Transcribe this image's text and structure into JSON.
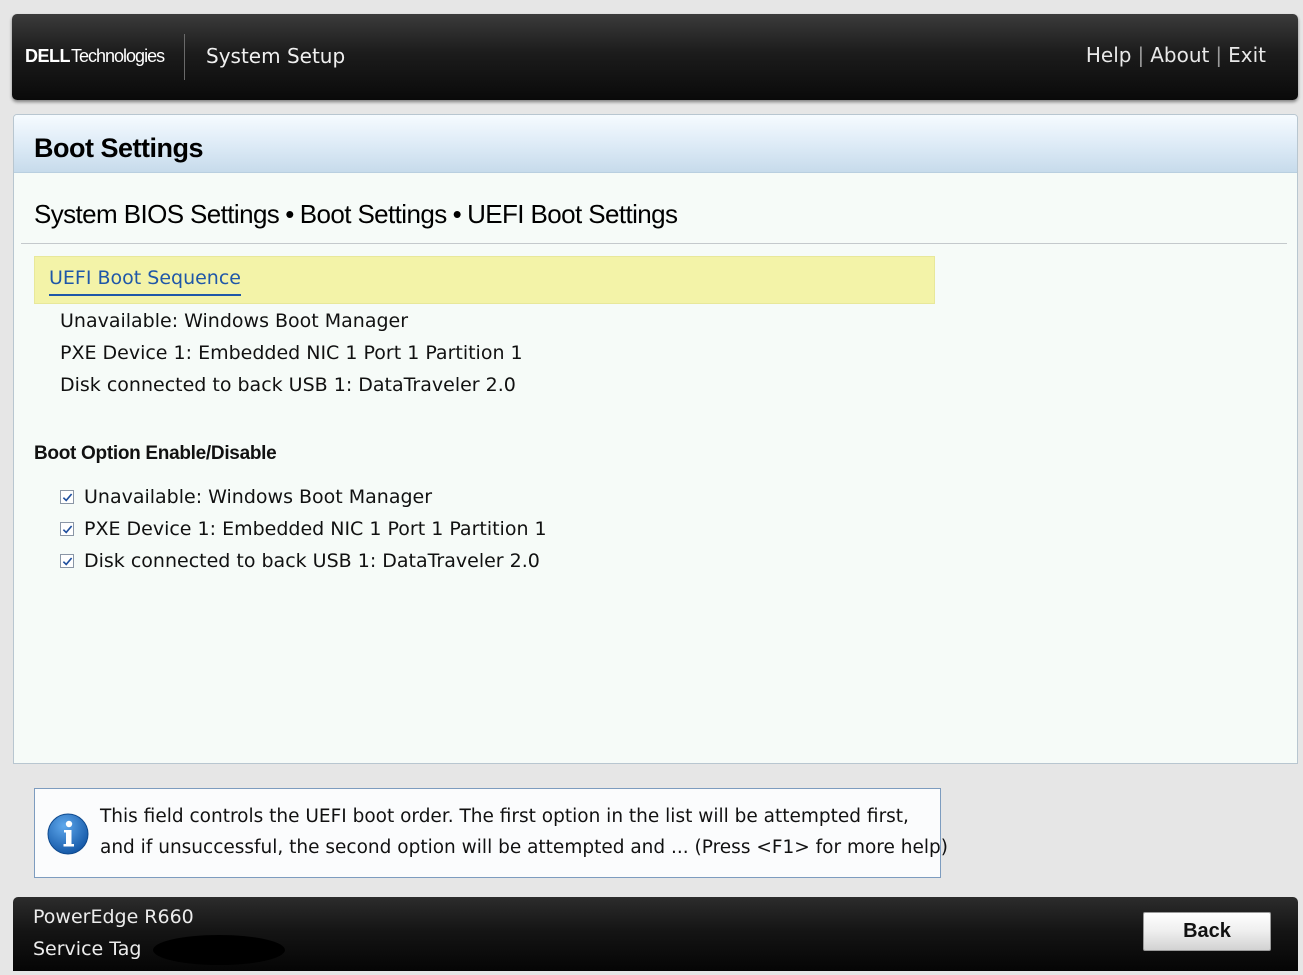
{
  "header": {
    "brand_dell": "DELL",
    "brand_tech": "Technologies",
    "app_title": "System Setup",
    "links": {
      "help": "Help",
      "about": "About",
      "exit": "Exit",
      "separator": "|"
    }
  },
  "page": {
    "title": "Boot Settings",
    "breadcrumb": [
      "System BIOS Settings",
      "Boot Settings",
      "UEFI Boot Settings"
    ],
    "breadcrumb_separator": "•"
  },
  "boot_sequence": {
    "label": "UEFI Boot Sequence",
    "items": [
      "Unavailable: Windows Boot Manager",
      "PXE Device 1: Embedded NIC 1 Port 1 Partition 1",
      "Disk connected to back USB 1: DataTraveler 2.0"
    ]
  },
  "boot_options": {
    "title": "Boot Option Enable/Disable",
    "items": [
      {
        "label": "Unavailable: Windows Boot Manager",
        "checked": true
      },
      {
        "label": "PXE Device 1: Embedded NIC 1 Port 1 Partition 1",
        "checked": true
      },
      {
        "label": "Disk connected to back USB 1: DataTraveler 2.0",
        "checked": true
      }
    ]
  },
  "help": {
    "icon": "info-icon",
    "line1": "This field controls the UEFI boot order. The first option in the list will be attempted first,",
    "line2": "and if unsuccessful, the second option will be attempted and ... (Press <F1> for more help)"
  },
  "footer": {
    "model": "PowerEdge R660",
    "service_tag_label": "Service Tag",
    "back_label": "Back"
  },
  "colors": {
    "selection": "#f3f3a8",
    "link": "#1f57a8",
    "panel_header": "#dceaf6",
    "info_icon": "#1d6fc4"
  }
}
